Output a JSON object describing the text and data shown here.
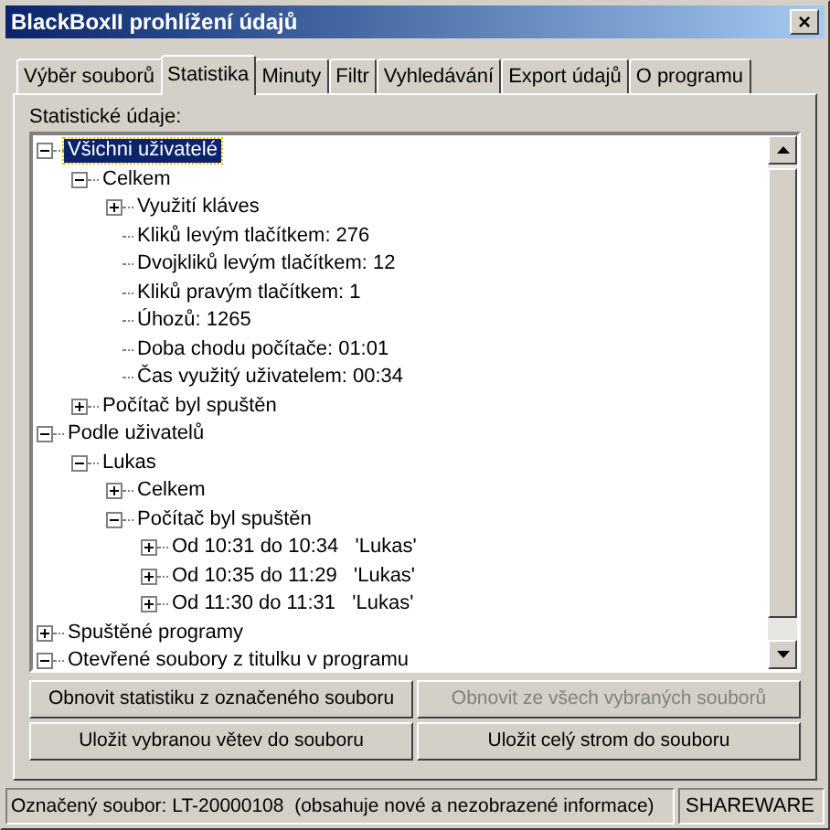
{
  "window": {
    "title": "BlackBoxII prohlížení údajů",
    "close": "×"
  },
  "tabs": [
    {
      "label": "Výběr souborů",
      "selected": false
    },
    {
      "label": "Statistika",
      "selected": true
    },
    {
      "label": "Minuty",
      "selected": false
    },
    {
      "label": "Filtr",
      "selected": false
    },
    {
      "label": "Vyhledávání",
      "selected": false
    },
    {
      "label": "Export údajů",
      "selected": false
    },
    {
      "label": "O programu",
      "selected": false
    }
  ],
  "group_label": "Statistické údaje:",
  "tree": [
    {
      "label": "Všichni uživatelé",
      "expanded": true,
      "selected": true,
      "children": [
        {
          "label": "Celkem",
          "expanded": true,
          "selected": false,
          "children": [
            {
              "label": "Využití kláves",
              "expanded": false,
              "selected": false
            },
            {
              "label": "Kliků levým tlačítkem: 276",
              "selected": false
            },
            {
              "label": "Dvojkliků levým tlačítkem: 12",
              "selected": false
            },
            {
              "label": "Kliků pravým tlačítkem: 1",
              "selected": false
            },
            {
              "label": "Úhozů: 1265",
              "selected": false
            },
            {
              "label": "Doba chodu počítače: 01:01",
              "selected": false
            },
            {
              "label": "Čas využitý uživatelem: 00:34",
              "selected": false
            }
          ]
        },
        {
          "label": "Počítač byl spuštěn",
          "expanded": false,
          "selected": false
        }
      ]
    },
    {
      "label": "Podle uživatelů",
      "expanded": true,
      "selected": false,
      "children": [
        {
          "label": "Lukas",
          "expanded": true,
          "selected": false,
          "children": [
            {
              "label": "Celkem",
              "expanded": false,
              "selected": false
            },
            {
              "label": "Počítač byl spuštěn",
              "expanded": true,
              "selected": false,
              "children": [
                {
                  "label": "Od 10:31 do 10:34   'Lukas'",
                  "expanded": false,
                  "selected": false
                },
                {
                  "label": "Od 10:35 do 11:29   'Lukas'",
                  "expanded": false,
                  "selected": false
                },
                {
                  "label": "Od 11:30 do 11:31   'Lukas'",
                  "expanded": false,
                  "selected": false
                }
              ]
            }
          ]
        }
      ]
    },
    {
      "label": "Spuštěné programy",
      "expanded": false,
      "selected": false
    },
    {
      "label": "Otevřené soubory z titulku v programu",
      "expanded": true,
      "selected": false
    }
  ],
  "buttons": [
    {
      "label": "Obnovit statistiku z označeného souboru",
      "disabled": false
    },
    {
      "label": "Obnovit ze všech vybraných souborů",
      "disabled": true
    },
    {
      "label": "Uložit vybranou větev do souboru",
      "disabled": false
    },
    {
      "label": "Uložit celý strom do souboru",
      "disabled": false
    }
  ],
  "status_bar": {
    "message": "Označený soubor: LT-20000108  (obsahuje nové a nezobrazené informace)",
    "license": "SHAREWARE"
  }
}
